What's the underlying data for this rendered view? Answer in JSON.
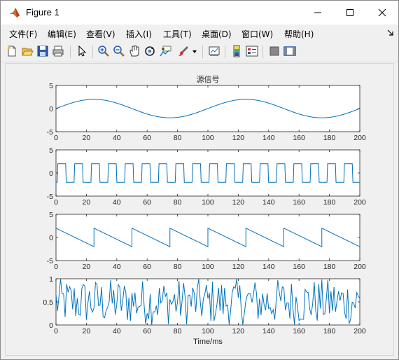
{
  "window": {
    "title": "Figure 1",
    "icon": "matlab-icon",
    "controls": [
      "minimize-icon",
      "maximize-icon",
      "close-icon"
    ]
  },
  "menu": {
    "items": [
      "文件(F)",
      "编辑(E)",
      "查看(V)",
      "插入(I)",
      "工具(T)",
      "桌面(D)",
      "窗口(W)",
      "帮助(H)"
    ],
    "dock_icon": "dock-arrow-icon"
  },
  "toolbar": {
    "icons": [
      "new-figure-icon",
      "open-file-icon",
      "save-icon",
      "print-icon",
      "pointer-icon",
      "zoom-in-icon",
      "zoom-out-icon",
      "pan-icon",
      "rotate-3d-icon",
      "data-cursor-icon",
      "brush-icon",
      "brush-dropdown-icon",
      "link-plot-icon",
      "colorbar-icon",
      "legend-icon",
      "hide-plot-tools-icon",
      "show-plot-tools-icon"
    ]
  },
  "colors": {
    "line": "#0072bd",
    "axes_bg": "#ffffff",
    "figure_bg": "#f0f0f0"
  },
  "chart_data": [
    {
      "type": "line",
      "title": "源信号",
      "xlabel": "",
      "ylabel": "",
      "xlim": [
        0,
        200
      ],
      "ylim": [
        -5,
        5
      ],
      "xticks": [
        0,
        20,
        40,
        60,
        80,
        100,
        120,
        140,
        160,
        180,
        200
      ],
      "yticks": [
        -5,
        0,
        5
      ],
      "series": [
        {
          "generator": "sine",
          "amplitude": 2,
          "period": 100,
          "x": [
            0,
            200
          ]
        }
      ]
    },
    {
      "type": "line",
      "title": "",
      "xlabel": "",
      "ylabel": "",
      "xlim": [
        0,
        200
      ],
      "ylim": [
        -5,
        5
      ],
      "xticks": [
        0,
        20,
        40,
        60,
        80,
        100,
        120,
        140,
        160,
        180,
        200
      ],
      "yticks": [
        -5,
        0,
        5
      ],
      "series": [
        {
          "generator": "square",
          "amplitude": 2,
          "period": 11.1,
          "x": [
            0,
            200
          ]
        }
      ]
    },
    {
      "type": "line",
      "title": "",
      "xlabel": "",
      "ylabel": "",
      "xlim": [
        0,
        200
      ],
      "ylim": [
        -5,
        5
      ],
      "xticks": [
        0,
        20,
        40,
        60,
        80,
        100,
        120,
        140,
        160,
        180,
        200
      ],
      "yticks": [
        -5,
        0,
        5
      ],
      "series": [
        {
          "generator": "sawtooth-down",
          "amplitude": 2,
          "period": 25,
          "x": [
            0,
            200
          ]
        }
      ]
    },
    {
      "type": "line",
      "title": "",
      "xlabel": "Time/ms",
      "ylabel": "",
      "xlim": [
        0,
        200
      ],
      "ylim": [
        0,
        1
      ],
      "xticks": [
        0,
        20,
        40,
        60,
        80,
        100,
        120,
        140,
        160,
        180,
        200
      ],
      "yticks": [
        0,
        0.5,
        1
      ],
      "series": [
        {
          "generator": "uniform-random",
          "range": [
            0,
            1
          ],
          "x": [
            0,
            200
          ]
        }
      ]
    }
  ]
}
